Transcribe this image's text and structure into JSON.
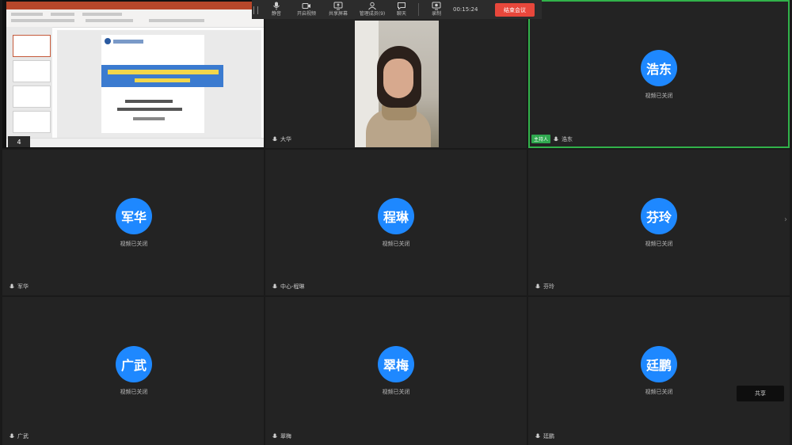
{
  "toolbar": {
    "items": [
      {
        "label": "静音",
        "icon": "mic-icon"
      },
      {
        "label": "开启视频",
        "icon": "camera-icon"
      },
      {
        "label": "共享屏幕",
        "icon": "share-screen-icon"
      },
      {
        "label": "管理成员(9)",
        "icon": "members-icon"
      },
      {
        "label": "聊天",
        "icon": "chat-icon"
      },
      {
        "label": "录制",
        "icon": "record-icon"
      }
    ],
    "time": "00:15:24",
    "end_label": "结束会议"
  },
  "share": {
    "page_indicator": "4"
  },
  "tiles": [
    {
      "type": "video",
      "name": "大华"
    },
    {
      "type": "avatar",
      "avatar_text": "浩东",
      "status": "视频已关闭",
      "name": "浩东",
      "host_badge": "主持人"
    },
    {
      "type": "avatar",
      "avatar_text": "军华",
      "status": "视频已关闭",
      "name": "军华"
    },
    {
      "type": "avatar",
      "avatar_text": "程琳",
      "status": "视频已关闭",
      "name": "中心-程琳"
    },
    {
      "type": "avatar",
      "avatar_text": "芬玲",
      "status": "视频已关闭",
      "name": "芬玲"
    },
    {
      "type": "avatar",
      "avatar_text": "广武",
      "status": "视频已关闭",
      "name": "广武"
    },
    {
      "type": "avatar",
      "avatar_text": "翠梅",
      "status": "视频已关闭",
      "name": "翠梅"
    },
    {
      "type": "avatar",
      "avatar_text": "廷鹏",
      "status": "视频已关闭",
      "name": "廷鹏"
    }
  ],
  "side_widget": "共享",
  "colors": {
    "avatar": "#1e88ff",
    "speaking_border": "#31b24a",
    "end_button": "#e8473b",
    "tile_bg": "#232323"
  }
}
